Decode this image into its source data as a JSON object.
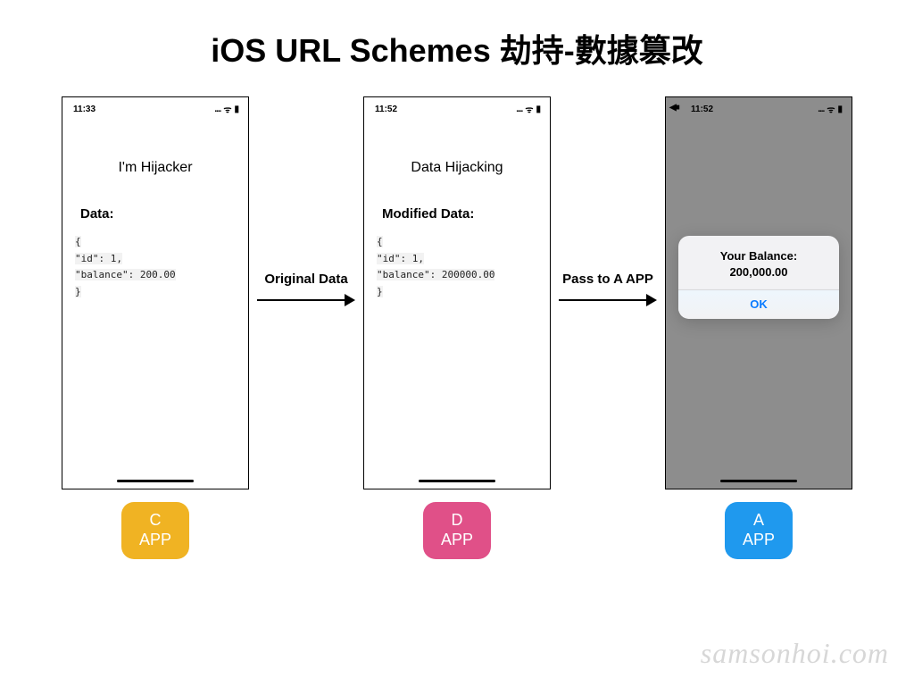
{
  "title": "iOS URL Schemes 劫持-數據篡改",
  "arrows": {
    "left": "Original Data",
    "right": "Pass to A APP"
  },
  "phones": {
    "c": {
      "time": "11:33",
      "headline": "I'm Hijacker",
      "data_label": "Data:",
      "code": {
        "open": "{",
        "l1": "  \"id\": 1,",
        "l2": "  \"balance\": 200.00",
        "close": "}"
      },
      "badge_top": "C",
      "badge_bottom": "APP"
    },
    "d": {
      "time": "11:52",
      "headline": "Data Hijacking",
      "data_label": "Modified Data:",
      "code": {
        "open": "{",
        "l1": "  \"id\": 1,",
        "l2": "  \"balance\": 200000.00",
        "close": "}"
      },
      "badge_top": "D",
      "badge_bottom": "APP"
    },
    "a": {
      "time": "11:52",
      "alert_line1": "Your Balance:",
      "alert_line2": "200,000.00",
      "alert_button": "OK",
      "badge_top": "A",
      "badge_bottom": "APP"
    }
  },
  "status_icons": "…ᯤ ▮",
  "watermark": "samsonhoi.com"
}
